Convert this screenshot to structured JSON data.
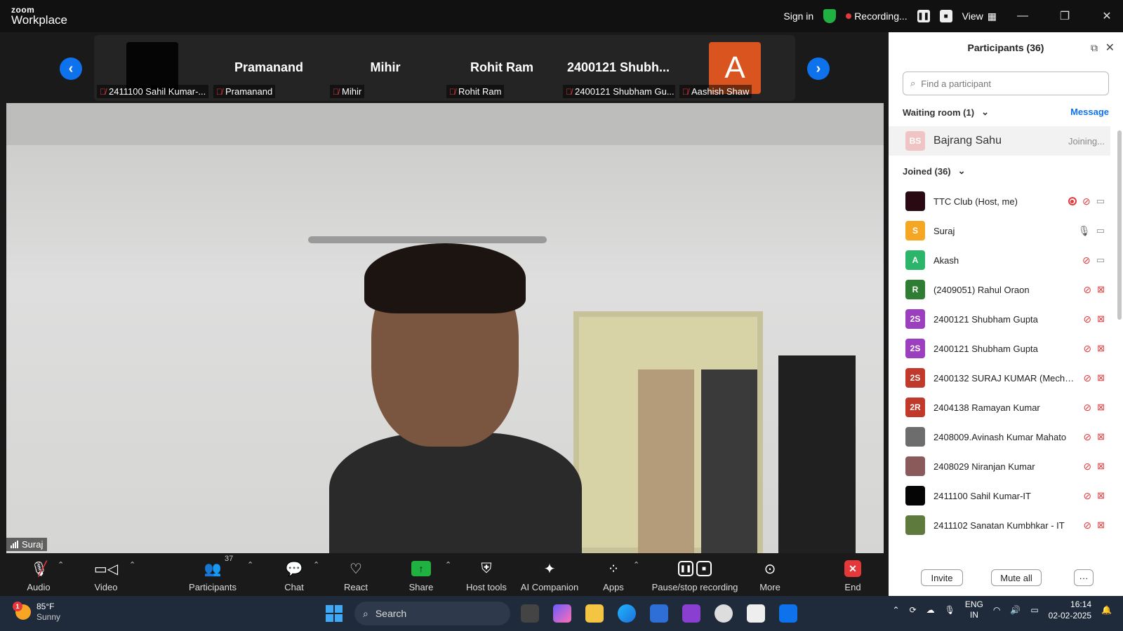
{
  "app": {
    "brand_top": "zoom",
    "brand_bottom": "Workplace"
  },
  "topbar": {
    "sign_in": "Sign in",
    "recording": "Recording...",
    "view": "View"
  },
  "strip": {
    "thumbs": [
      {
        "big": "",
        "label": "2411100 Sahil Kumar-..."
      },
      {
        "big": "Pramanand",
        "label": "Pramanand"
      },
      {
        "big": "Mihir",
        "label": "Mihir"
      },
      {
        "big": "Rohit Ram",
        "label": "Rohit Ram"
      },
      {
        "big": "2400121 Shubh...",
        "label": "2400121 Shubham Gu..."
      },
      {
        "big": "A",
        "label": "Aashish Shaw"
      }
    ]
  },
  "main_video": {
    "speaker_name": "Suraj"
  },
  "toolbar": {
    "audio": "Audio",
    "video": "Video",
    "participants": "Participants",
    "participants_count": "37",
    "chat": "Chat",
    "react": "React",
    "share": "Share",
    "host_tools": "Host tools",
    "ai_companion": "AI Companion",
    "apps": "Apps",
    "pause_stop": "Pause/stop recording",
    "more": "More",
    "end": "End"
  },
  "panel": {
    "title": "Participants (36)",
    "search_placeholder": "Find a participant",
    "waiting_room": "Waiting room (1)",
    "message": "Message",
    "waiting": {
      "initials": "BS",
      "name": "Bajrang Sahu",
      "status": "Joining..."
    },
    "joined": "Joined (36)",
    "participants": [
      {
        "initials": "",
        "name": "TTC Club (Host, me)",
        "color": "#2a0a12",
        "mic": "off",
        "cam": "on",
        "rec": true
      },
      {
        "initials": "S",
        "name": "Suraj",
        "color": "#f5a623",
        "mic": "on",
        "cam": "on",
        "rec": false
      },
      {
        "initials": "A",
        "name": "Akash",
        "color": "#2bb56b",
        "mic": "off",
        "cam": "on",
        "rec": false
      },
      {
        "initials": "R",
        "name": "(2409051) Rahul Oraon",
        "color": "#2e7d32",
        "mic": "off",
        "cam": "off",
        "rec": false
      },
      {
        "initials": "2S",
        "name": "2400121 Shubham Gupta",
        "color": "#9c3fbf",
        "mic": "off",
        "cam": "off",
        "rec": false
      },
      {
        "initials": "2S",
        "name": "2400121 Shubham Gupta",
        "color": "#9c3fbf",
        "mic": "off",
        "cam": "off",
        "rec": false
      },
      {
        "initials": "2S",
        "name": "2400132 SURAJ KUMAR (Mecha...",
        "color": "#c0392b",
        "mic": "off",
        "cam": "off",
        "rec": false
      },
      {
        "initials": "2R",
        "name": "2404138   Ramayan Kumar",
        "color": "#c0392b",
        "mic": "off",
        "cam": "off",
        "rec": false
      },
      {
        "initials": "",
        "name": "2408009.Avinash Kumar Mahato",
        "color": "#6d6d6d",
        "mic": "off",
        "cam": "off",
        "rec": false
      },
      {
        "initials": "",
        "name": "2408029 Niranjan Kumar",
        "color": "#8a5a5a",
        "mic": "off",
        "cam": "off",
        "rec": false
      },
      {
        "initials": "",
        "name": "2411100 Sahil Kumar-IT",
        "color": "#050505",
        "mic": "off",
        "cam": "off",
        "rec": false
      },
      {
        "initials": "",
        "name": "2411102 Sanatan Kumbhkar - IT",
        "color": "#5e7a3c",
        "mic": "off",
        "cam": "off",
        "rec": false
      }
    ],
    "invite": "Invite",
    "mute_all": "Mute all",
    "more": "···"
  },
  "taskbar": {
    "temp": "85°F",
    "weather": "Sunny",
    "weather_badge": "1",
    "search": "Search",
    "lang_top": "ENG",
    "lang_bottom": "IN",
    "time": "16:14",
    "date": "02-02-2025"
  },
  "colors": {
    "accent": "#0e72ed",
    "danger": "#e5383b",
    "green": "#1fb141"
  }
}
